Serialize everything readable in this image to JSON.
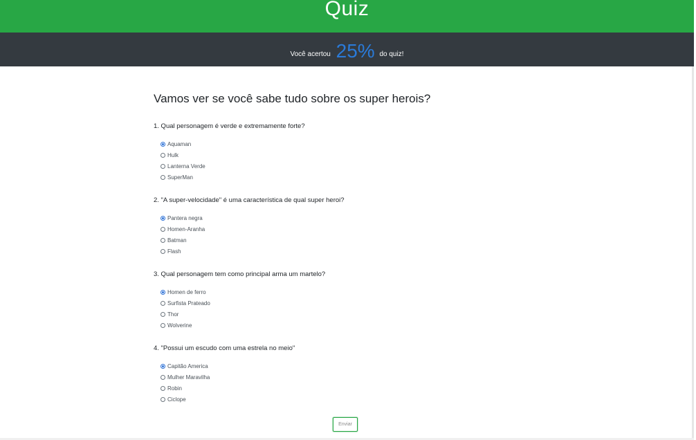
{
  "header": {
    "title": "Quiz"
  },
  "score": {
    "prefix": "Você acertou",
    "value": "25%",
    "suffix": "do quiz!"
  },
  "heading": "Vamos ver se você sabe tudo sobre os super herois?",
  "questions": [
    {
      "text": "1. Qual personagem é verde e extremamente forte?",
      "options": [
        "Aquaman",
        "Hulk",
        "Lanterna Verde",
        "SuperMan"
      ],
      "selected": 0
    },
    {
      "text": "2. \"A super-velocidade\" é uma característica de qual super heroi?",
      "options": [
        "Pantera negra",
        "Homen-Aranha",
        "Batman",
        "Flash"
      ],
      "selected": 0
    },
    {
      "text": "3. Qual personagem tem como principal arma um martelo?",
      "options": [
        "Homen de ferro",
        "Surfista Prateado",
        "Thor",
        "Wolverine"
      ],
      "selected": 0
    },
    {
      "text": "4. \"Possui um escudo com uma estrela no meio\"",
      "options": [
        "Capitão America",
        "Mulher Maravilha",
        "Robin",
        "Ciclope"
      ],
      "selected": 0
    }
  ],
  "submit_label": "Enviar",
  "colors": {
    "header_bg": "#28a745",
    "scorebar_bg": "#343a40",
    "score_accent": "#2a7ad8",
    "radio_checked": "#2a6fd6"
  }
}
